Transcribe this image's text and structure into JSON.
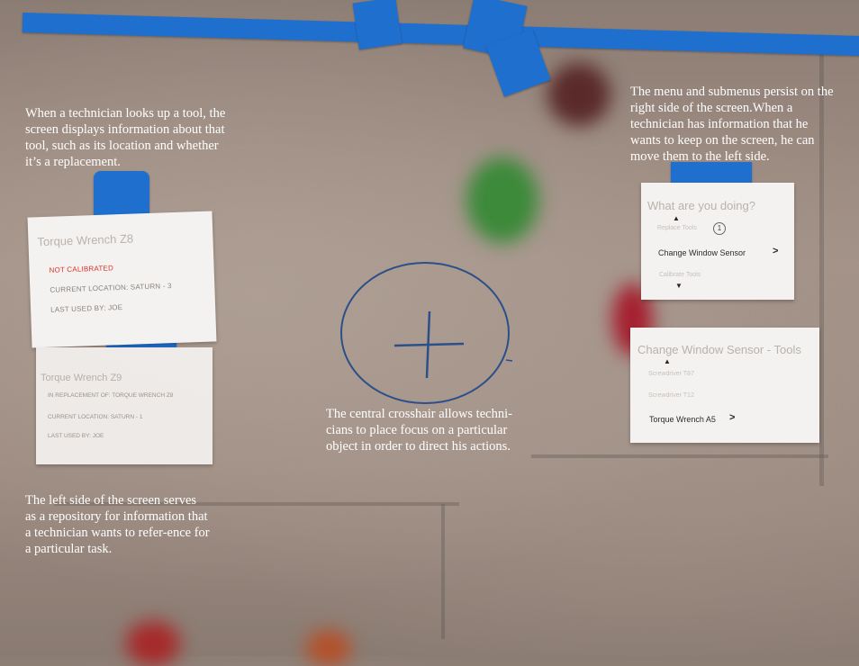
{
  "captions": {
    "tool_lookup": "When a technician looks up a tool, the screen displays information about that tool, such as its location and whether it’s a replacement.",
    "menu_persist": "The menu and submenus persist on the right side of the screen.When a technician has information that he wants to keep on the screen, he can move them to the left side.",
    "crosshair": "The central crosshair allows techni-cians to place focus on a particular object in order to direct his actions.",
    "left_repository": "The left side of the screen serves as a repository for information that a technician wants to refer-ence for a particular task."
  },
  "tool_card_1": {
    "title": "Torque Wrench Z8",
    "status": "NOT CALIBRATED",
    "location": "CURRENT LOCATION: SATURN - 3",
    "last_used": "LAST USED BY: JOE"
  },
  "tool_card_2": {
    "title": "Torque Wrench Z9",
    "replacement": "IN REPLACEMENT OF: TORQUE WRENCH Z8",
    "location": "CURRENT LOCATION: SATURN - 1",
    "last_used": "LAST USED BY: JOE"
  },
  "menu": {
    "title": "What are you doing?",
    "item_above": "Replace Tools",
    "item_above_badge": "1",
    "selected": "Change Window Sensor",
    "item_below": "Calibrate Tools"
  },
  "submenu": {
    "title": "Change Window Sensor - Tools",
    "item_1": "Screwdriver T87",
    "item_2": "Screwdriver T12",
    "selected": "Torque Wrench A5"
  },
  "colors": {
    "tape": "#1f6fcf",
    "status_red": "#d9322a",
    "crosshair": "#2b4f8a"
  }
}
